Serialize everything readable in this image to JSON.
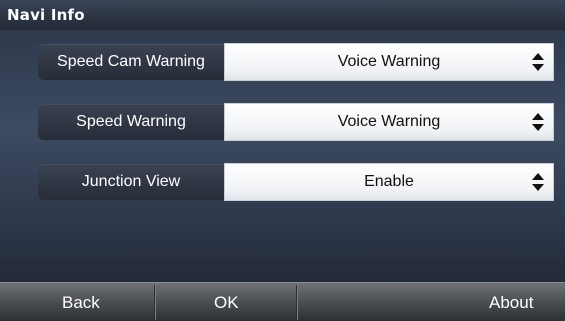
{
  "title": "Navi Info",
  "settings": [
    {
      "label": "Speed Cam Warning",
      "value": "Voice Warning"
    },
    {
      "label": "Speed Warning",
      "value": "Voice Warning"
    },
    {
      "label": "Junction View",
      "value": "Enable"
    }
  ],
  "footer": {
    "back": "Back",
    "ok": "OK",
    "about": "About"
  },
  "icons": {
    "stepper": "up-down-arrows-icon"
  }
}
